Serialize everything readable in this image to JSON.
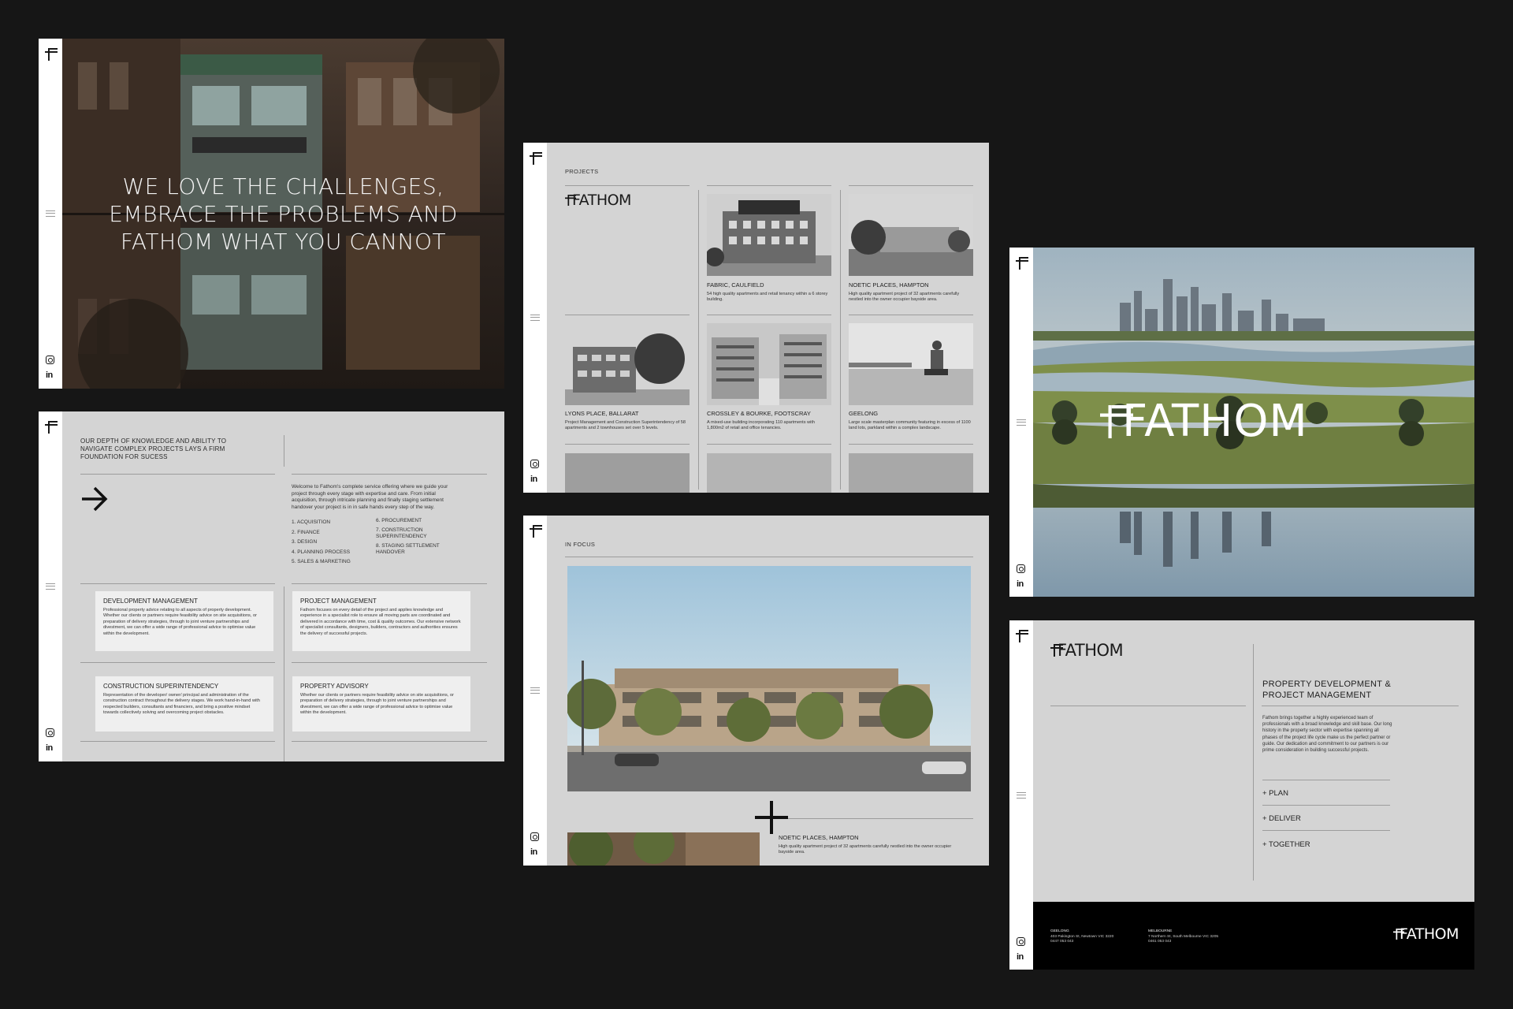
{
  "colors": {
    "page_bg": "#161616",
    "panel_bg": "#d4d4d4",
    "rail_bg": "#ffffff",
    "ink": "#1a1a1a",
    "footer_bg": "#000000"
  },
  "icons": {
    "logo": "fathom-f-mark-icon",
    "menu": "menu-lines-icon",
    "instagram": "instagram-icon",
    "linkedin": "linkedin-icon",
    "arrow": "arrow-right-icon",
    "plus": "plus-cross-icon"
  },
  "social": {
    "linkedin": "in"
  },
  "brand": {
    "name": "FATHOM"
  },
  "hero": {
    "headline": [
      "WE LOVE THE CHALLENGES,",
      "EMBRACE THE PROBLEMS AND",
      "FATHOM WHAT YOU CANNOT"
    ]
  },
  "services": {
    "intro": "OUR DEPTH OF KNOWLEDGE AND ABILITY TO NAVIGATE COMPLEX PROJECTS LAYS A FIRM FOUNDATION FOR SUCESS",
    "welcome": "Welcome to Fathom's complete service offering where we guide your project through every stage with expertise and care. From initial acquisition, through intricate planning and finally staging settlement handover your project is in in safe hands every step of the way.",
    "steps_left": [
      "1. ACQUISITION",
      "2. FINANCE",
      "3. DESIGN",
      "4. PLANNING PROCESS",
      "5. SALES & MARKETING"
    ],
    "steps_right": [
      "6. PROCUREMENT",
      "7. CONSTRUCTION SUPERINTENDENCY",
      "8. STAGING SETTLEMENT HANDOVER"
    ],
    "cards": [
      {
        "title": "DEVELOPMENT MANAGEMENT",
        "body": "Professional property advice relating to all aspects of property development. Whether our clients or partners require feasibility advice on site acquisitions, or preparation of delivery strategies, through to joint venture partnerships and divestment, we can offer a wide range of professional advice to optimise value within the development."
      },
      {
        "title": "PROJECT MANAGEMENT",
        "body": "Fathom focuses on every detail of the project and applies knowledge and experience in a specialist role to ensure all moving parts are coordinated and delivered in accordance with time, cost & quality outcomes. Our extensive network of specialist consultants, designers, builders, contractors and authorities ensures the delivery of successful projects."
      },
      {
        "title": "CONSTRUCTION SUPERINTENDENCY",
        "body": "Representation of the developer/ owner/ principal and administration of the construction contract throughout the delivery stages. We work hand-in-hand with respected builders, consultants and financiers, and bring a positive mindset towards collectively solving and overcoming project obstacles."
      },
      {
        "title": "PROPERTY ADVISORY",
        "body": "Whether our clients or partners require feasibility advice on site acquisitions, or preparation of delivery strategies, through to joint venture partnerships and divestment, we can offer a wide range of professional advice to optimise value within the development."
      }
    ]
  },
  "projects": {
    "label": "PROJECTS",
    "items": [
      {
        "title": "FABRIC, CAULFIELD",
        "desc": "54 high quality apartments and retail tenancy within a 6 storey building."
      },
      {
        "title": "NOETIC PLACES, HAMPTON",
        "desc": "High quality apartment project of 32 apartments carefully nestled into the owner occupier bayside area."
      },
      {
        "title": "LYONS PLACE, BALLARAT",
        "desc": "Project Management and Construction Superintendency of 58 apartments and 2 townhouses set over 5 levels."
      },
      {
        "title": "CROSSLEY & BOURKE, FOOTSCRAY",
        "desc": "A mixed-use building incorporating 110 apartments with 1,800m2 of retail and office tenancies."
      },
      {
        "title": "GEELONG",
        "desc": "Large scale masterplan community featuring in excess of 1100 land lots, parkland within a complex landscape."
      }
    ]
  },
  "focus": {
    "label": "IN FOCUS",
    "project_title": "NOETIC PLACES, HAMPTON",
    "project_desc": "High quality apartment project of 32 apartments carefully nestled into the owner occupier bayside area."
  },
  "about": {
    "heading": "PROPERTY DEVELOPMENT & PROJECT MANAGEMENT",
    "body": "Fathom brings together a highly experienced team of professionals with a broad knowledge and skill base. Our long history in the property sector with expertise spanning all phases of the project life cycle make us the perfect partner or guide. Our dedication and commitment to our partners is our prime consideration in building successful projects.",
    "links": [
      "+ PLAN",
      "+ DELIVER",
      "+ TOGETHER"
    ],
    "offices": [
      {
        "city": "GEELONG",
        "address": "403 Pakington St, Newtown VIC 3220",
        "phone": "0447 053 043"
      },
      {
        "city": "MELBOURNE",
        "address": "7 Northern St, South Melbourne VIC 3205",
        "phone": "0461 053 043"
      }
    ]
  }
}
